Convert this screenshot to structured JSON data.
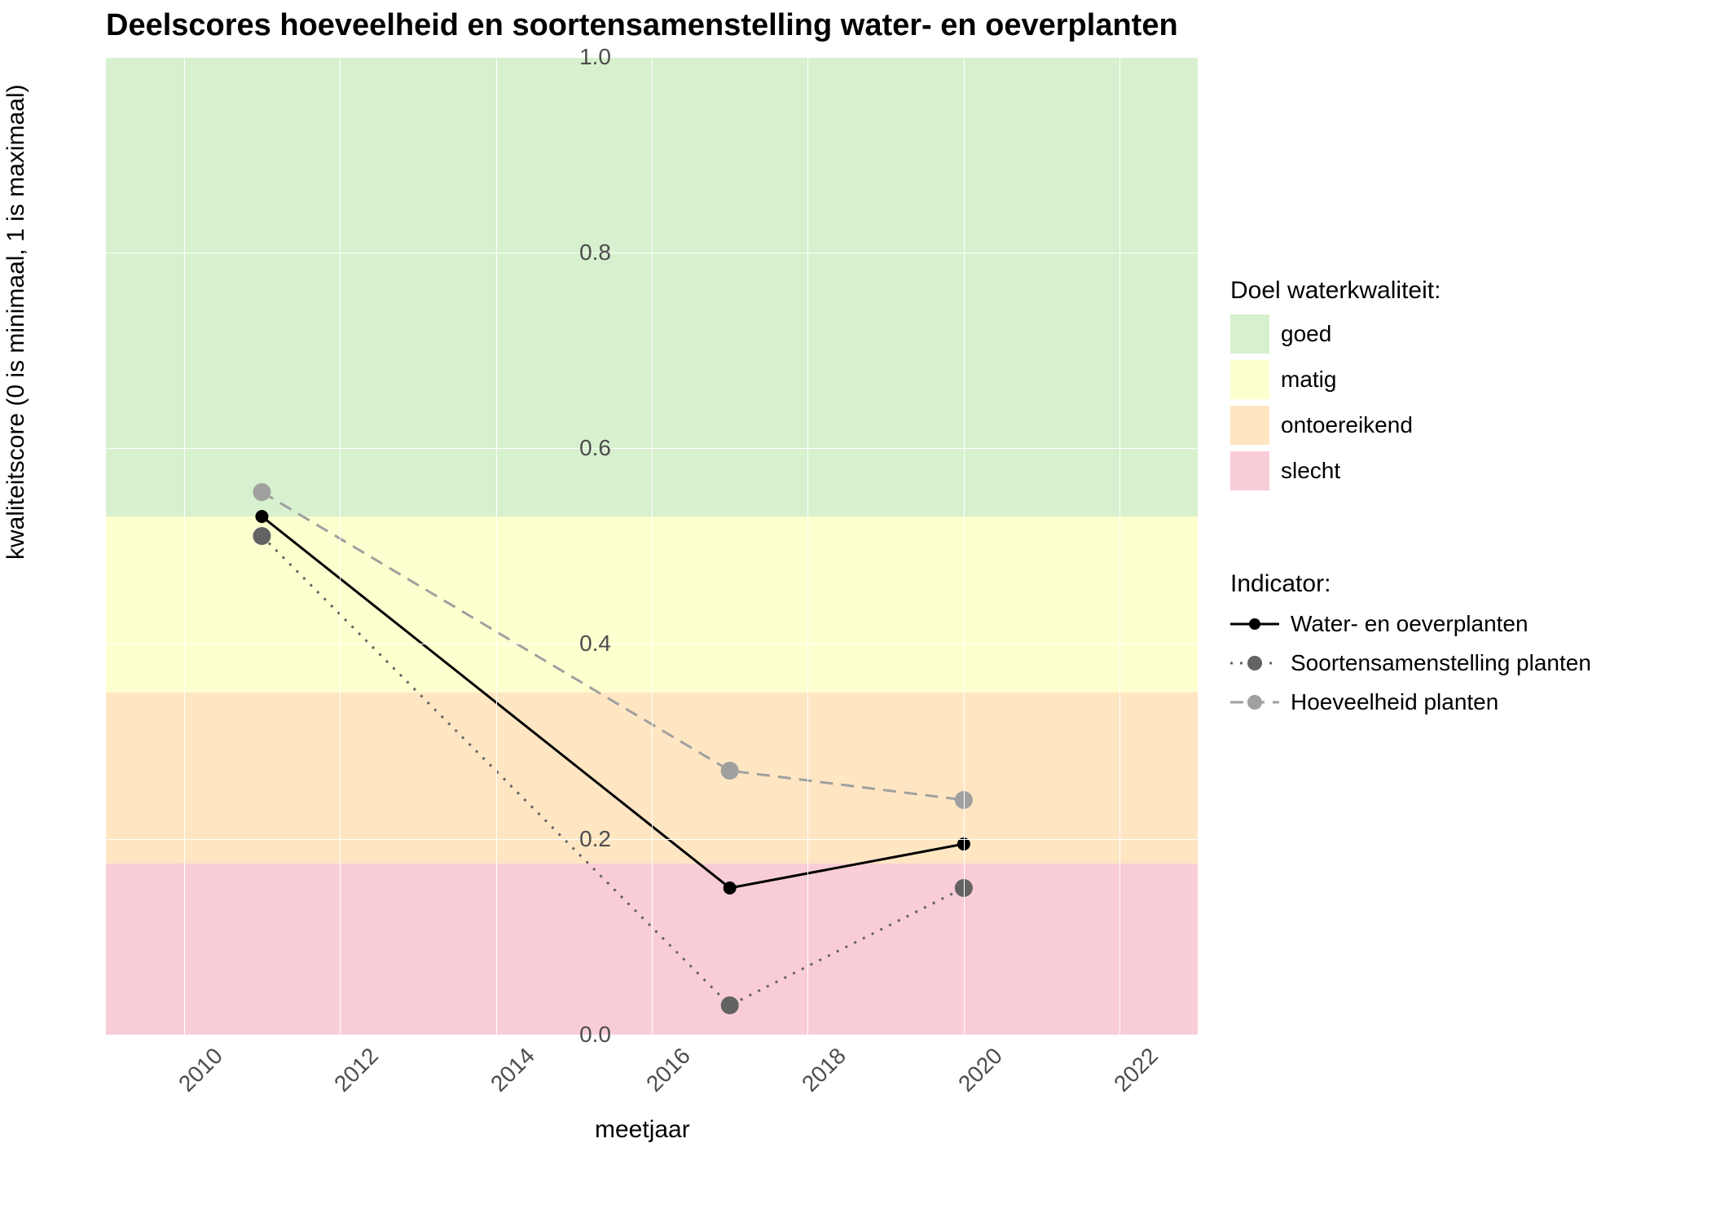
{
  "chart_data": {
    "type": "line",
    "title": "Deelscores hoeveelheid en soortensamenstelling water- en oeverplanten",
    "xlabel": "meetjaar",
    "ylabel": "kwaliteitscore (0 is minimaal, 1 is maximaal)",
    "xlim": [
      2009,
      2023
    ],
    "ylim": [
      0.0,
      1.0
    ],
    "x_ticks": [
      2010,
      2012,
      2014,
      2016,
      2018,
      2020,
      2022
    ],
    "y_ticks": [
      0.0,
      0.2,
      0.4,
      0.6,
      0.8,
      1.0
    ],
    "bands": [
      {
        "name": "goed",
        "ymin": 0.53,
        "ymax": 1.0,
        "color": "#d7f0ce"
      },
      {
        "name": "matig",
        "ymin": 0.35,
        "ymax": 0.53,
        "color": "#feffcf"
      },
      {
        "name": "ontoereikend",
        "ymin": 0.175,
        "ymax": 0.35,
        "color": "#fee6c3"
      },
      {
        "name": "slecht",
        "ymin": 0.0,
        "ymax": 0.175,
        "color": "#f9cdd8"
      }
    ],
    "series": [
      {
        "name": "Water- en oeverplanten",
        "color": "#000000",
        "dash": "solid",
        "x": [
          2011,
          2017,
          2020
        ],
        "y": [
          0.53,
          0.15,
          0.195
        ]
      },
      {
        "name": "Soortensamenstelling planten",
        "color": "#636363",
        "dash": "dotted",
        "x": [
          2011,
          2017,
          2020
        ],
        "y": [
          0.51,
          0.03,
          0.15
        ]
      },
      {
        "name": "Hoeveelheid planten",
        "color": "#a0a0a0",
        "dash": "dashed",
        "x": [
          2011,
          2017,
          2020
        ],
        "y": [
          0.555,
          0.27,
          0.24
        ]
      }
    ],
    "legend_quality_title": "Doel waterkwaliteit:",
    "legend_indicator_title": "Indicator:"
  }
}
